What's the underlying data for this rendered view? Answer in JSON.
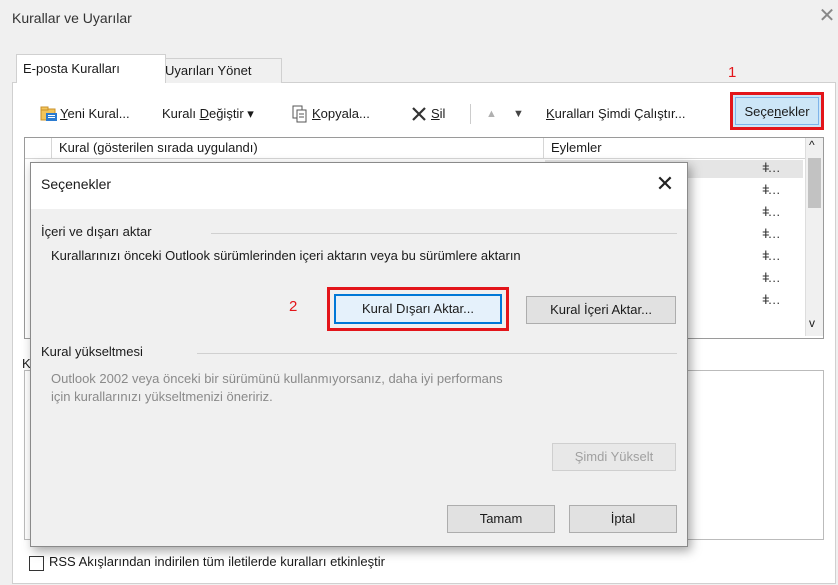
{
  "window": {
    "title": "Kurallar ve Uyarılar",
    "close_glyph": "✕"
  },
  "tabs": [
    {
      "label": "E-posta Kuralları",
      "active": true
    },
    {
      "label": "Uyarıları Yönet",
      "active": false
    }
  ],
  "toolbar": {
    "new_rule": {
      "pre": "",
      "ul": "Y",
      "post": "eni Kural..."
    },
    "change_rule": {
      "pre": "Kuralı ",
      "ul": "D",
      "post": "eğiştir ▾"
    },
    "copy": {
      "pre": "",
      "ul": "K",
      "post": "opyala..."
    },
    "delete": {
      "pre": "",
      "ul": "S",
      "post": "il"
    },
    "run_now": {
      "pre": "",
      "ul": "K",
      "post": "uralları Şimdi Çalıştır..."
    },
    "options": {
      "pre": "Seçe",
      "ul": "n",
      "post": "ekler"
    },
    "up_arrow": "▲",
    "down_arrow": "▼"
  },
  "annotations": {
    "marker1": "1",
    "marker2": "2"
  },
  "rules_list": {
    "col_rule": "Kural (gösterilen sırada uygulandı)",
    "col_actions": "Eylemler",
    "action_icon_count": 7,
    "scroll_up": "^",
    "scroll_down": "v"
  },
  "bottom": {
    "section_letter": "K",
    "rss_label": "RSS Akışlarından indirilen tüm iletilerde kuralları etkinleştir"
  },
  "dialog": {
    "title": "Seçenekler",
    "close_glyph": "✕",
    "import_export": {
      "title": "İçeri ve dışarı aktar",
      "description": "Kurallarınızı önceki Outlook sürümlerinden içeri aktarın veya bu sürümlere aktarın",
      "export_button": "Kural Dışarı Aktar...",
      "import_button": "Kural İçeri Aktar..."
    },
    "upgrade": {
      "title": "Kural yükseltmesi",
      "description_line1": "Outlook 2002 veya önceki bir sürümünü kullanmıyorsanız, daha iyi performans",
      "description_line2": "için kurallarınızı yükseltmenizi öneririz.",
      "upgrade_button": "Şimdi Yükselt"
    },
    "ok_button": "Tamam",
    "cancel_button": "İptal"
  },
  "colors": {
    "highlight_red": "#e3151a",
    "options_bg": "#cde6f7",
    "focus_blue": "#0078d7"
  }
}
